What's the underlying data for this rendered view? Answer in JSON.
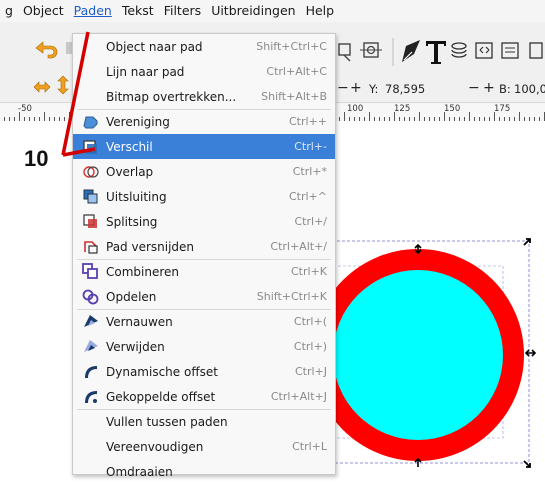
{
  "menubar": {
    "items": [
      "g",
      "Object",
      "Paden",
      "Tekst",
      "Filters",
      "Uitbreidingen",
      "Help"
    ],
    "active_index": 2
  },
  "toolbar": {
    "y_label": "Y:",
    "y_value": "78,595",
    "b_label": "B:",
    "b_value": "100,0",
    "minus": "−",
    "plus": "+"
  },
  "ruler": {
    "labels": [
      "-50",
      "100",
      "125",
      "150",
      "175"
    ]
  },
  "menu": {
    "items": [
      {
        "label": "Object naar pad",
        "shortcut": "Shift+Ctrl+C",
        "icon": "none"
      },
      {
        "label": "Lijn naar pad",
        "shortcut": "Ctrl+Alt+C",
        "icon": "none"
      },
      {
        "label": "Bitmap overtrekken...",
        "shortcut": "Shift+Alt+B",
        "icon": "none"
      },
      {
        "label": "Vereniging",
        "shortcut": "Ctrl++",
        "icon": "union-icon"
      },
      {
        "label": "Verschil",
        "shortcut": "Ctrl+-",
        "icon": "difference-icon"
      },
      {
        "label": "Overlap",
        "shortcut": "Ctrl+*",
        "icon": "intersection-icon"
      },
      {
        "label": "Uitsluiting",
        "shortcut": "Ctrl+^",
        "icon": "exclusion-icon"
      },
      {
        "label": "Splitsing",
        "shortcut": "Ctrl+/",
        "icon": "division-icon"
      },
      {
        "label": "Pad versnijden",
        "shortcut": "Ctrl+Alt+/",
        "icon": "cut-path-icon"
      },
      {
        "label": "Combineren",
        "shortcut": "Ctrl+K",
        "icon": "combine-icon"
      },
      {
        "label": "Opdelen",
        "shortcut": "Shift+Ctrl+K",
        "icon": "break-apart-icon"
      },
      {
        "label": "Vernauwen",
        "shortcut": "Ctrl+(",
        "icon": "inset-icon"
      },
      {
        "label": "Verwijden",
        "shortcut": "Ctrl+)",
        "icon": "outset-icon"
      },
      {
        "label": "Dynamische offset",
        "shortcut": "Ctrl+J",
        "icon": "dynamic-offset-icon"
      },
      {
        "label": "Gekoppelde offset",
        "shortcut": "Ctrl+Alt+J",
        "icon": "linked-offset-icon"
      },
      {
        "label": "Vullen tussen paden",
        "shortcut": "",
        "icon": "none"
      },
      {
        "label": "Vereenvoudigen",
        "shortcut": "Ctrl+L",
        "icon": "none"
      },
      {
        "label": "Omdraaien",
        "shortcut": "",
        "icon": "none"
      }
    ],
    "highlighted_index": 4
  },
  "callout": {
    "number": "10"
  },
  "colors": {
    "highlight": "#3a7fd8",
    "ring": "#ff0000",
    "disk": "#00ffff",
    "annotation": "#d40000"
  }
}
